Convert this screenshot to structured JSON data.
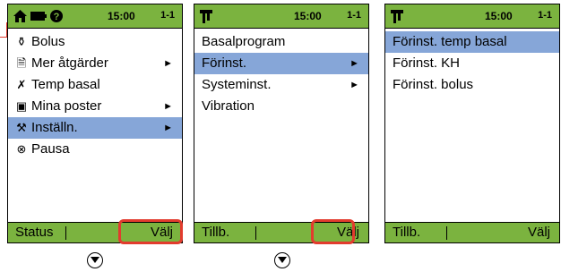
{
  "screens": [
    {
      "time": "15:00",
      "page": "1-1",
      "items": [
        {
          "label": "Bolus",
          "icon": "vial-icon",
          "glyph": "⚱",
          "arrow": false,
          "selected": false
        },
        {
          "label": "Mer åtgärder",
          "icon": "document-icon",
          "glyph": "🗎",
          "arrow": true,
          "selected": false
        },
        {
          "label": "Temp basal",
          "icon": "running-person-icon",
          "glyph": "✗",
          "arrow": false,
          "selected": false
        },
        {
          "label": "Mina poster",
          "icon": "records-icon",
          "glyph": "▣",
          "arrow": true,
          "selected": false
        },
        {
          "label": "Inställn.",
          "icon": "settings-tool-icon",
          "glyph": "⚒",
          "arrow": true,
          "selected": true
        },
        {
          "label": "Pausa",
          "icon": "pause-cancel-icon",
          "glyph": "⊗",
          "arrow": false,
          "selected": false
        }
      ],
      "softkey_left": "Status",
      "softkey_right": "Välj"
    },
    {
      "time": "15:00",
      "page": "1-1",
      "items": [
        {
          "label": "Basalprogram",
          "arrow": false,
          "selected": false
        },
        {
          "label": "Förinst.",
          "arrow": true,
          "selected": true
        },
        {
          "label": "Systeminst.",
          "arrow": true,
          "selected": false
        },
        {
          "label": "Vibration",
          "arrow": false,
          "selected": false
        }
      ],
      "softkey_left": "Tillb.",
      "softkey_right": "Välj"
    },
    {
      "time": "15:00",
      "page": "1-1",
      "items": [
        {
          "label": "Förinst. temp basal",
          "arrow": false,
          "selected": true
        },
        {
          "label": "Förinst. KH",
          "arrow": false,
          "selected": false
        },
        {
          "label": "Förinst. bolus",
          "arrow": false,
          "selected": false
        }
      ],
      "softkey_left": "Tillb.",
      "softkey_right": "Välj"
    }
  ],
  "arrow_glyph": "►",
  "colors": {
    "status_bar": "#7bb33f",
    "selection": "#86a6d8",
    "highlight": "#e23b2e"
  }
}
